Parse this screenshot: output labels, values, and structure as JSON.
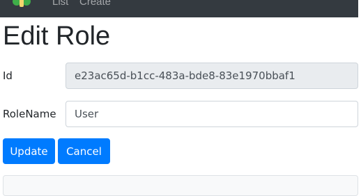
{
  "navbar": {
    "links": [
      {
        "label": "List"
      },
      {
        "label": "Create"
      }
    ],
    "background": "#343a40"
  },
  "page": {
    "title": "Edit Role"
  },
  "form": {
    "id_label": "Id",
    "id_value": "e23ac65d-b1cc-483a-bde8-83e1970bbaf1",
    "rolename_label": "RoleName",
    "rolename_value": "User"
  },
  "buttons": {
    "update_label": "Update",
    "cancel_label": "Cancel",
    "accent": "#007bff"
  }
}
